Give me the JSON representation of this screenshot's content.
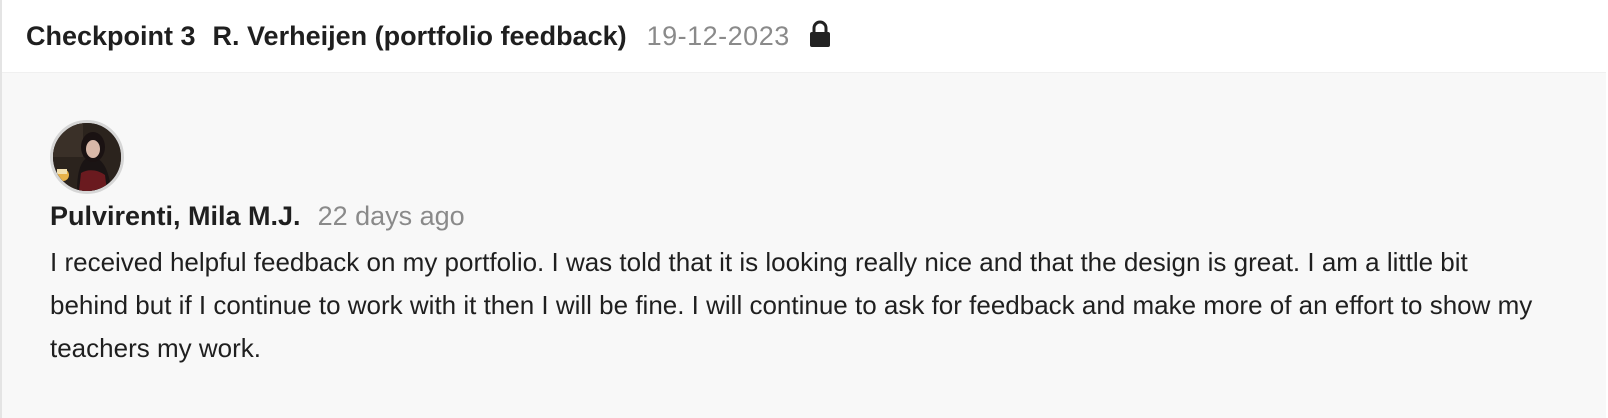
{
  "header": {
    "checkpoint_label": "Checkpoint 3",
    "title": "R. Verheijen (portfolio feedback)",
    "date": "19-12-2023",
    "lock_icon": "lock-icon"
  },
  "comment": {
    "avatar_icon": "user-avatar",
    "author": "Pulvirenti, Mila M.J.",
    "time_ago": "22 days ago",
    "text": "I received helpful feedback on my portfolio. I was told that it is looking really nice and that the design is great. I am a little bit behind but if I continue to work with it then I will be fine. I will continue to ask for feedback and make more of an effort to show my teachers my work."
  },
  "colors": {
    "text_primary": "#1f1f1f",
    "text_muted": "#8a8a8a",
    "body_background": "#f8f8f8",
    "header_background": "#ffffff"
  }
}
